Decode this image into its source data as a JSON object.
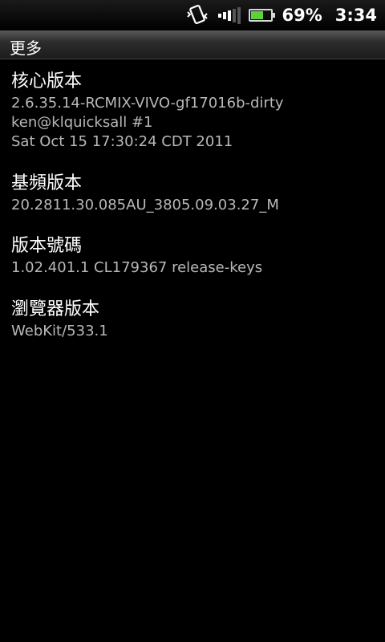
{
  "status_bar": {
    "vibrate_icon": "vibrate-icon",
    "signal_icon": "signal-icon",
    "battery_icon": "battery-icon",
    "battery_level": 0.69,
    "battery_text": "69%",
    "time": "3:34",
    "battery_color": "#5fd13c"
  },
  "header": {
    "title": "更多"
  },
  "info_items": [
    {
      "title": "核心版本",
      "lines": [
        "2.6.35.14-RCMIX-VIVO-gf17016b-dirty",
        "ken@klquicksall #1",
        "Sat Oct 15 17:30:24 CDT 2011"
      ]
    },
    {
      "title": "基頻版本",
      "lines": [
        "20.2811.30.085AU_3805.09.03.27_M"
      ]
    },
    {
      "title": "版本號碼",
      "lines": [
        "1.02.401.1 CL179367 release-keys"
      ]
    },
    {
      "title": "瀏覽器版本",
      "lines": [
        "WebKit/533.1"
      ]
    }
  ]
}
